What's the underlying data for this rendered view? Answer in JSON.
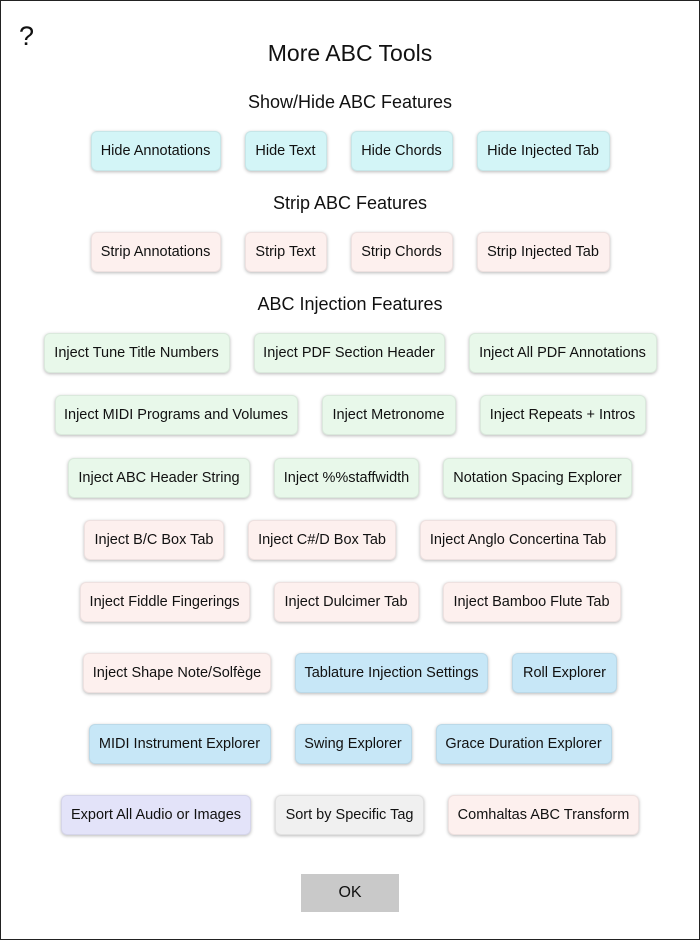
{
  "dialog": {
    "help_label": "?",
    "title": "More ABC Tools",
    "ok_label": "OK"
  },
  "sections": {
    "show_hide": "Show/Hide ABC Features",
    "strip": "Strip ABC Features",
    "injection": "ABC Injection Features"
  },
  "buttons": {
    "hide_annotations": "Hide Annotations",
    "hide_text": "Hide Text",
    "hide_chords": "Hide Chords",
    "hide_injected_tab": "Hide Injected Tab",
    "strip_annotations": "Strip Annotations",
    "strip_text": "Strip Text",
    "strip_chords": "Strip Chords",
    "strip_injected_tab": "Strip Injected Tab",
    "inject_tune_title_numbers": "Inject Tune Title Numbers",
    "inject_pdf_section_header": "Inject PDF Section Header",
    "inject_all_pdf_annotations": "Inject All PDF Annotations",
    "inject_midi_programs_volumes": "Inject MIDI Programs and Volumes",
    "inject_metronome": "Inject Metronome",
    "inject_repeats_intros": "Inject Repeats + Intros",
    "inject_abc_header_string": "Inject ABC Header String",
    "inject_staffwidth": "Inject %%staffwidth",
    "notation_spacing_explorer": "Notation Spacing Explorer",
    "inject_bc_box_tab": "Inject B/C Box Tab",
    "inject_csharp_d_box_tab": "Inject C#/D Box Tab",
    "inject_anglo_concertina_tab": "Inject Anglo Concertina Tab",
    "inject_fiddle_fingerings": "Inject Fiddle Fingerings",
    "inject_dulcimer_tab": "Inject Dulcimer Tab",
    "inject_bamboo_flute_tab": "Inject Bamboo Flute Tab",
    "inject_shape_note_solfege": "Inject Shape Note/Solfège",
    "tablature_injection_settings": "Tablature Injection Settings",
    "roll_explorer": "Roll Explorer",
    "midi_instrument_explorer": "MIDI Instrument Explorer",
    "swing_explorer": "Swing Explorer",
    "grace_duration_explorer": "Grace Duration Explorer",
    "export_all_audio_images": "Export All Audio or Images",
    "sort_by_specific_tag": "Sort by Specific Tag",
    "comhaltas_abc_transform": "Comhaltas ABC Transform"
  },
  "colors": {
    "show_hide": "#d3f5f7",
    "strip": "#fdf0ee",
    "inject_general": "#e8f8ea",
    "inject_tab": "#fdf0ee",
    "explorers": "#c7e7f7",
    "export": "#e3e3f9",
    "sort": "#f0f0f0",
    "ok_button": "#c9c9c9"
  }
}
